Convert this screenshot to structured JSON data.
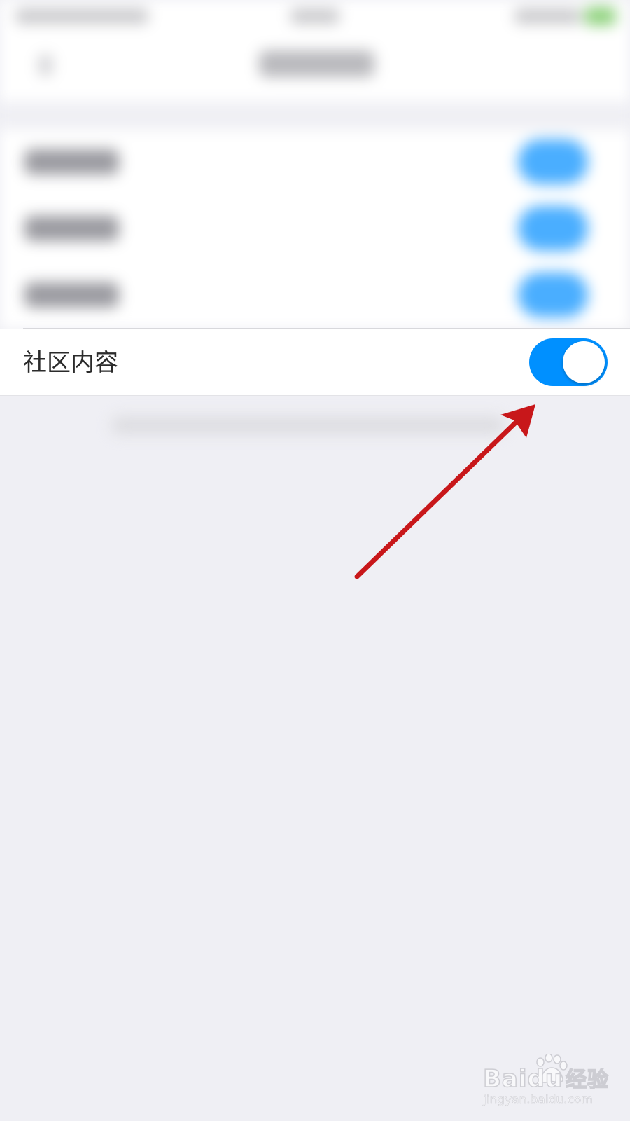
{
  "setting": {
    "label": "社区内容",
    "toggle_on": true
  },
  "colors": {
    "toggle_on": "#0090ff",
    "arrow": "#c8171a",
    "background": "#efeff4"
  },
  "watermark": {
    "logo_text": "Bai",
    "logo_text_2": "du",
    "logo_cn": "经验",
    "url": "jingyan.baidu.com"
  },
  "icons": {
    "annotation": "red-arrow-icon",
    "watermark": "baidu-paw-icon"
  }
}
